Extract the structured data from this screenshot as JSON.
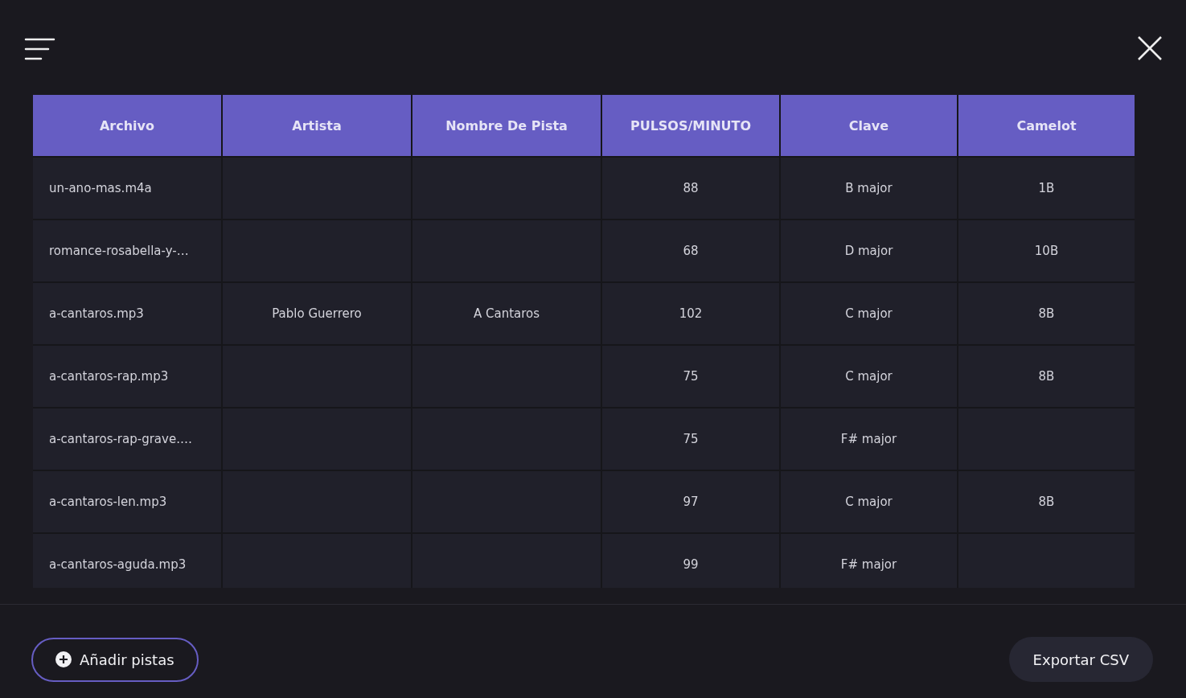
{
  "table": {
    "columns": [
      "Archivo",
      "Artista",
      "Nombre De Pista",
      "PULSOS/MINUTO",
      "Clave",
      "Camelot"
    ],
    "rows": [
      [
        "un-ano-mas.m4a",
        null,
        null,
        "88",
        "B major",
        "1B"
      ],
      [
        "romance-rosabella-y-…",
        null,
        null,
        "68",
        "D major",
        "10B"
      ],
      [
        "a-cantaros.mp3",
        "Pablo Guerrero",
        "A Cantaros",
        "102",
        "C major",
        "8B"
      ],
      [
        "a-cantaros-rap.mp3",
        null,
        null,
        "75",
        "C major",
        "8B"
      ],
      [
        "a-cantaros-rap-grave.…",
        null,
        null,
        "75",
        "F# major",
        null
      ],
      [
        "a-cantaros-len.mp3",
        null,
        null,
        "97",
        "C major",
        "8B"
      ],
      [
        "a-cantaros-aguda.mp3",
        null,
        null,
        "99",
        "F# major",
        null
      ]
    ]
  },
  "footer": {
    "add_button": "Añadir pistas",
    "export_button": "Exportar CSV"
  }
}
